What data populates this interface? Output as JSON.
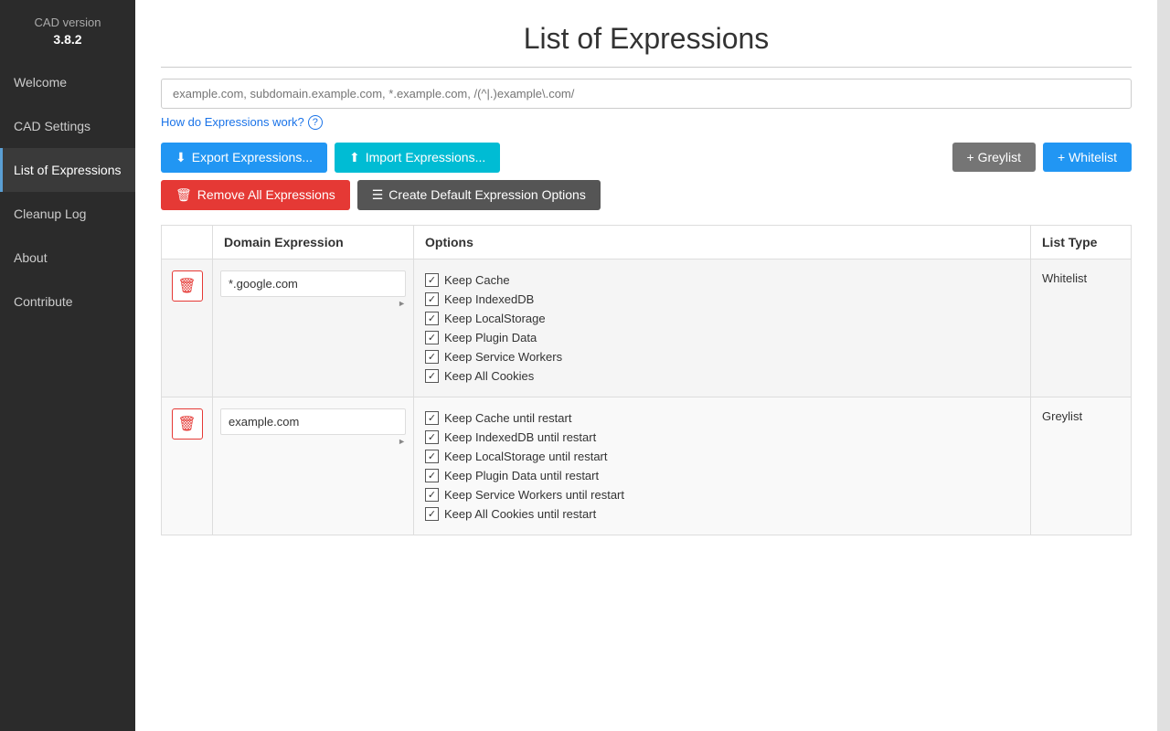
{
  "sidebar": {
    "version_label": "CAD version",
    "version_number": "3.8.2",
    "items": [
      {
        "id": "welcome",
        "label": "Welcome",
        "active": false
      },
      {
        "id": "cad-settings",
        "label": "CAD Settings",
        "active": false
      },
      {
        "id": "list-of-expressions",
        "label": "List of Expressions",
        "active": true
      },
      {
        "id": "cleanup-log",
        "label": "Cleanup Log",
        "active": false
      },
      {
        "id": "about",
        "label": "About",
        "active": false
      },
      {
        "id": "contribute",
        "label": "Contribute",
        "active": false
      }
    ]
  },
  "main": {
    "page_title": "List of Expressions",
    "search_placeholder": "example.com, subdomain.example.com, *.example.com, /(^|.)example\\.com/",
    "how_link": "How do Expressions work?",
    "buttons": {
      "export": "Export Expressions...",
      "import": "Import Expressions...",
      "greylist": "+ Greylist",
      "whitelist": "+ Whitelist",
      "remove_all": "Remove All Expressions",
      "create_default": "Create Default Expression Options"
    },
    "table": {
      "headers": [
        "",
        "Domain Expression",
        "Options",
        "List Type"
      ],
      "rows": [
        {
          "domain": "*.google.com",
          "list_type": "Whitelist",
          "options": [
            {
              "label": "Keep Cache",
              "checked": true
            },
            {
              "label": "Keep IndexedDB",
              "checked": true
            },
            {
              "label": "Keep LocalStorage",
              "checked": true
            },
            {
              "label": "Keep Plugin Data",
              "checked": true
            },
            {
              "label": "Keep Service Workers",
              "checked": true
            },
            {
              "label": "Keep All Cookies",
              "checked": true
            }
          ]
        },
        {
          "domain": "example.com",
          "list_type": "Greylist",
          "options": [
            {
              "label": "Keep Cache until restart",
              "checked": true
            },
            {
              "label": "Keep IndexedDB until restart",
              "checked": true
            },
            {
              "label": "Keep LocalStorage until restart",
              "checked": true
            },
            {
              "label": "Keep Plugin Data until restart",
              "checked": true
            },
            {
              "label": "Keep Service Workers until restart",
              "checked": true
            },
            {
              "label": "Keep All Cookies until restart",
              "checked": true
            }
          ]
        }
      ]
    }
  }
}
